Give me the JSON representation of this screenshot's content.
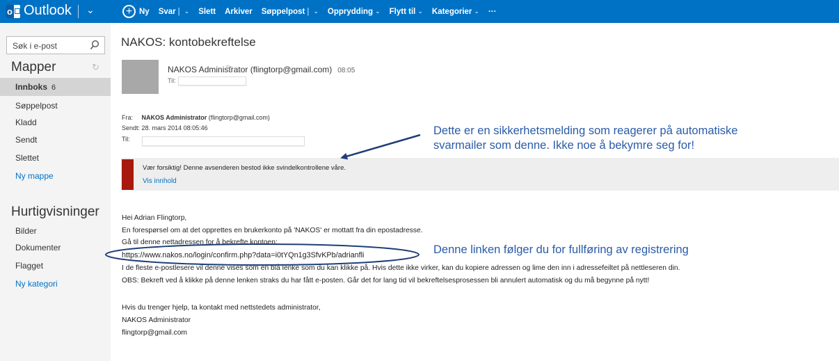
{
  "app": {
    "title": "Outlook"
  },
  "toolbar": {
    "new_label": "Ny",
    "reply_label": "Svar",
    "delete_label": "Slett",
    "archive_label": "Arkiver",
    "junk_label": "Søppelpost",
    "sweep_label": "Opprydding",
    "move_label": "Flytt til",
    "categories_label": "Kategorier",
    "more_label": "···"
  },
  "search": {
    "placeholder": "Søk i e-post"
  },
  "nav": {
    "folders_heading": "Mapper",
    "folders": [
      {
        "label": "Innboks",
        "count": "6"
      },
      {
        "label": "Søppelpost"
      },
      {
        "label": "Kladd"
      },
      {
        "label": "Sendt"
      },
      {
        "label": "Slettet"
      }
    ],
    "new_folder": "Ny mappe",
    "quickviews_heading": "Hurtigvisninger",
    "quickviews": [
      {
        "label": "Bilder"
      },
      {
        "label": "Dokumenter"
      },
      {
        "label": "Flagget"
      }
    ],
    "new_category": "Ny kategori"
  },
  "message": {
    "subject": "NAKOS: kontobekreftelse",
    "sender": "NAKOS Administrator (flingtorp@gmail.com)",
    "time": "08:05",
    "to_label": "Til:",
    "fwd": {
      "from_label": "Fra:",
      "from_name": "NAKOS Administrator",
      "from_email": "(flingtorp@gmail.com)",
      "sent_label": "Sendt:",
      "sent_value": "28. mars 2014 08:05:46",
      "to_label": "Til:"
    },
    "warning": {
      "text": "Vær forsiktig! Denne avsenderen bestod ikke svindelkontrollene våre.",
      "link": "Vis innhold"
    },
    "body": {
      "greeting": "Hei Adrian Flingtorp,",
      "line1": "En forespørsel om at det opprettes en brukerkonto på 'NAKOS' er mottatt fra din epostadresse.",
      "line2": "Gå til denne nettadressen for å bekrefte kontoen:",
      "url": "https://www.nakos.no/login/confirm.php?data=i0tYQn1g3SfvKPb/adrianfli",
      "line3": "I de fleste e-postlesere vil denne vises som en blå lenke som du kan klikke på. Hvis dette ikke virker, kan du kopiere adressen og lime den inn i adressefeiltet på nettleseren din.",
      "line4": "OBS: Bekreft ved å klikke på denne lenken straks du har fått e-posten. Går det for lang tid vil bekreftelsesprosessen bli annulert automatisk og du må begynne på nytt!",
      "help": "Hvis du trenger hjelp, ta kontakt med nettstedets administrator,",
      "sig_name": "NAKOS Administrator",
      "sig_email": "flingtorp@gmail.com"
    }
  },
  "annotations": {
    "security_line1": "Dette er en sikkerhetsmelding som reagerer på automatiske",
    "security_line2": "svarmailer som denne. Ikke noe å bekymre seg for!",
    "link_note": "Denne linken følger du for fullføring av registrering"
  },
  "colors": {
    "topbar": "#0072c6",
    "warning_bar": "#a8180e",
    "annotation": "#2a5ba8",
    "link": "#0072c6"
  }
}
